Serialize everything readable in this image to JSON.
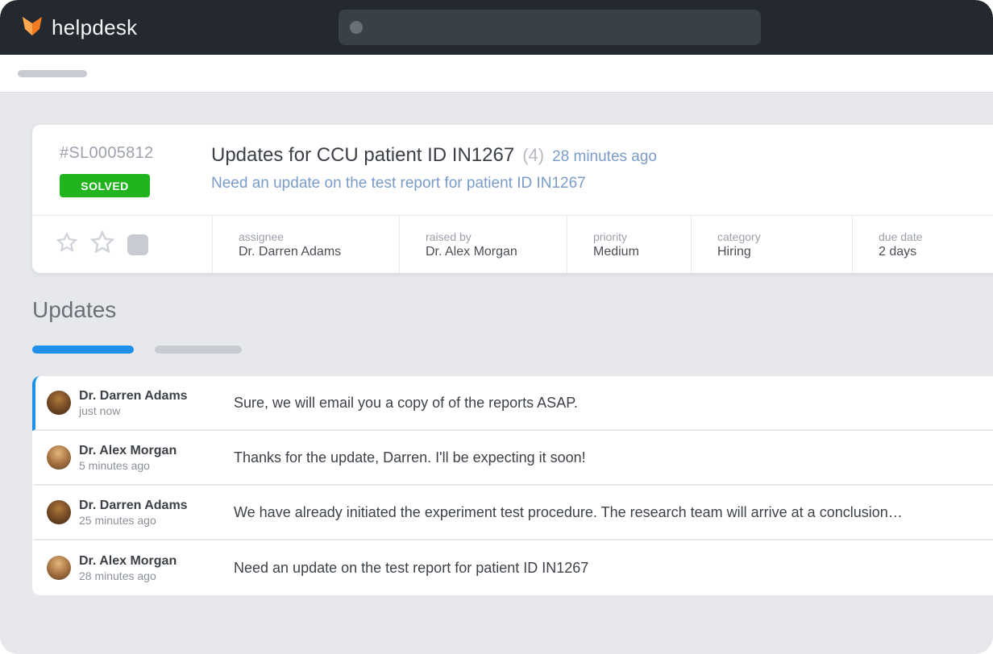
{
  "brand": {
    "name": "helpdesk"
  },
  "ticket": {
    "id": "#SL0005812",
    "status": "SOLVED",
    "title": "Updates for CCU patient ID IN1267",
    "count": "(4)",
    "time": "28 minutes ago",
    "description": "Need an update on the test report for patient ID IN1267",
    "meta": {
      "assignee_label": "assignee",
      "assignee_value": "Dr. Darren Adams",
      "raised_label": "raised by",
      "raised_value": "Dr. Alex Morgan",
      "priority_label": "priority",
      "priority_value": "Medium",
      "category_label": "category",
      "category_value": "Hiring",
      "due_label": "due date",
      "due_value": "2 days"
    }
  },
  "updates_section": {
    "title": "Updates"
  },
  "updates": [
    {
      "author": "Dr. Darren Adams",
      "time": "just now",
      "message": "Sure, we will email you a copy of of the reports ASAP."
    },
    {
      "author": "Dr. Alex Morgan",
      "time": "5 minutes ago",
      "message": "Thanks for the update, Darren. I'll be expecting it soon!"
    },
    {
      "author": "Dr. Darren Adams",
      "time": "25 minutes ago",
      "message": "We have already initiated the experiment test procedure. The research team will arrive at a conclusion…"
    },
    {
      "author": "Dr. Alex Morgan",
      "time": "28 minutes ago",
      "message": "Need an update on the test report for patient ID IN1267"
    }
  ]
}
